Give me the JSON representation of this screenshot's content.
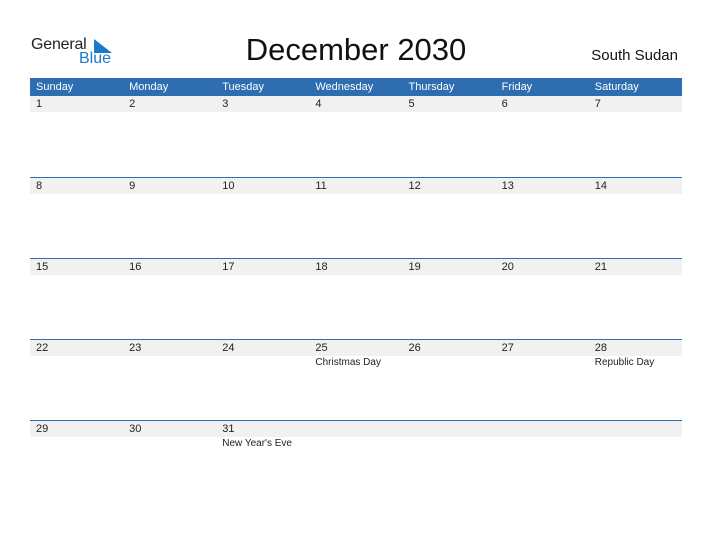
{
  "logo": {
    "general": "General",
    "blue": "Blue"
  },
  "title": "December 2030",
  "country": "South Sudan",
  "colors": {
    "header_bg": "#2e6db0",
    "logo_blue": "#1e78c8",
    "row_band": "#f1f1f1"
  },
  "weekdays": [
    "Sunday",
    "Monday",
    "Tuesday",
    "Wednesday",
    "Thursday",
    "Friday",
    "Saturday"
  ],
  "weeks": [
    {
      "days": [
        "1",
        "2",
        "3",
        "4",
        "5",
        "6",
        "7"
      ],
      "holidays": [
        "",
        "",
        "",
        "",
        "",
        "",
        ""
      ]
    },
    {
      "days": [
        "8",
        "9",
        "10",
        "11",
        "12",
        "13",
        "14"
      ],
      "holidays": [
        "",
        "",
        "",
        "",
        "",
        "",
        ""
      ]
    },
    {
      "days": [
        "15",
        "16",
        "17",
        "18",
        "19",
        "20",
        "21"
      ],
      "holidays": [
        "",
        "",
        "",
        "",
        "",
        "",
        ""
      ]
    },
    {
      "days": [
        "22",
        "23",
        "24",
        "25",
        "26",
        "27",
        "28"
      ],
      "holidays": [
        "",
        "",
        "",
        "Christmas Day",
        "",
        "",
        "Republic Day"
      ]
    },
    {
      "days": [
        "29",
        "30",
        "31",
        "",
        "",
        "",
        ""
      ],
      "holidays": [
        "",
        "",
        "New Year's Eve",
        "",
        "",
        "",
        ""
      ]
    }
  ]
}
